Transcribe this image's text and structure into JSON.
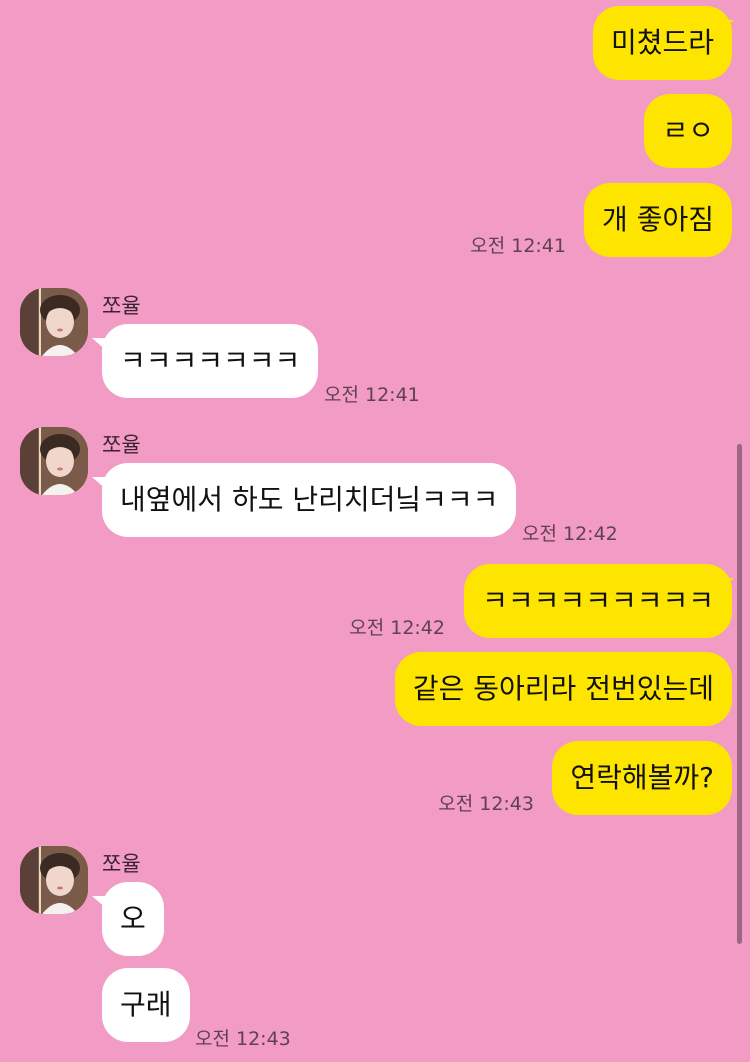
{
  "contact": {
    "name": "쪼율",
    "avatar_icon": "profile-photo-icon"
  },
  "colors": {
    "background": "#f29bc4",
    "outgoing_bubble": "#fee500",
    "incoming_bubble": "#ffffff"
  },
  "messages": [
    {
      "direction": "out",
      "text": "미쳤드라"
    },
    {
      "direction": "out",
      "text": "ㄹㅇ"
    },
    {
      "direction": "out",
      "text": "개 좋아짐",
      "time": "오전 12:41"
    },
    {
      "direction": "in",
      "sender": "쪼율",
      "text": "ㅋㅋㅋㅋㅋㅋㅋ",
      "time": "오전 12:41"
    },
    {
      "direction": "in",
      "sender": "쪼율",
      "text": "내옆에서 하도 난리치더닠ㅋㅋㅋ",
      "time": "오전 12:42"
    },
    {
      "direction": "out",
      "text": "ㅋㅋㅋㅋㅋㅋㅋㅋㅋ",
      "time": "오전 12:42"
    },
    {
      "direction": "out",
      "text": "같은 동아리라 전번있는데"
    },
    {
      "direction": "out",
      "text": "연락해볼까?",
      "time": "오전 12:43"
    },
    {
      "direction": "in",
      "sender": "쪼율",
      "text": "오"
    },
    {
      "direction": "in",
      "sender": "쪼율",
      "text": "구래",
      "time": "오전 12:43"
    }
  ]
}
